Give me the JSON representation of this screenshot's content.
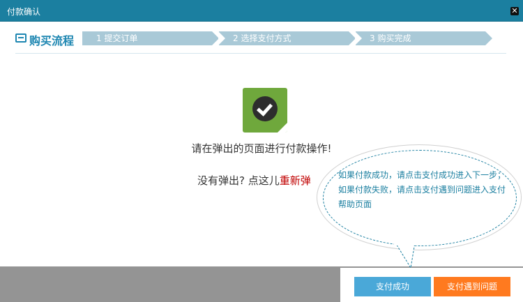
{
  "dialog": {
    "title": "付款确认",
    "close_icon": "close-icon"
  },
  "steps": {
    "header_title": "购买流程",
    "items": [
      {
        "label": "1 提交订单"
      },
      {
        "label": "2 选择支付方式"
      },
      {
        "label": "3 购买完成"
      }
    ]
  },
  "main": {
    "status_icon": "check-icon",
    "message": "请在弹出的页面进行付款操作!",
    "no_popup_prefix": "没有弹出? 点这儿",
    "reopen_link": "重新弹"
  },
  "tooltip": {
    "line1": "如果付款成功，请点击支付成功进入下一步；",
    "line2": "如果付款失败，请点击支付遇到问题进入支付帮助页面"
  },
  "buttons": {
    "success": "支付成功",
    "problem": "支付遇到问题"
  },
  "colors": {
    "titlebar": "#1b7fa0",
    "step_fill": "#a9c9d7",
    "success_button": "#4aa8d8",
    "problem_button": "#ff7a1f",
    "link": "#c00000",
    "tooltip_text": "#1b7fa0"
  }
}
